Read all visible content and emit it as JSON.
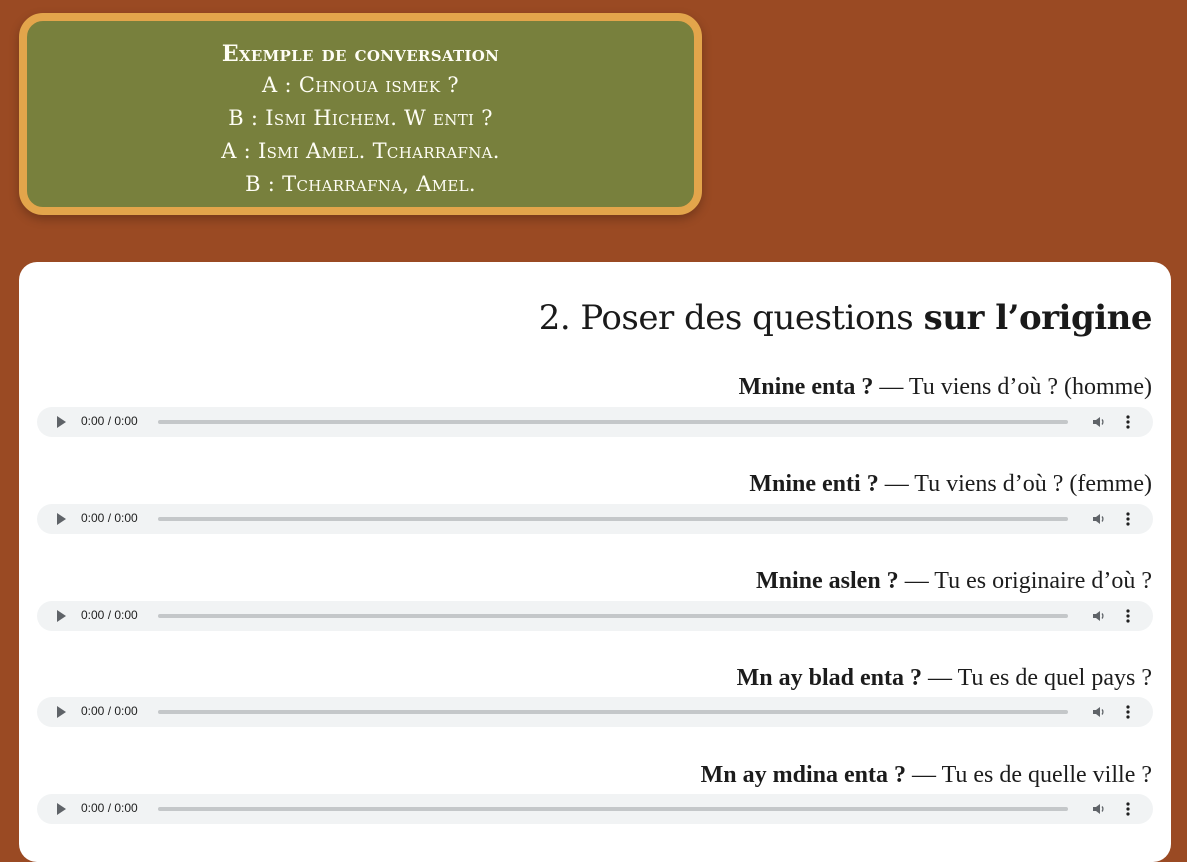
{
  "conversation": {
    "title": "Exemple de conversation",
    "lines": [
      "A : Chnoua ismek ?",
      "B : Ismi Hichem. W enti ?",
      "A : Ismi Amel. Tcharrafna.",
      "B : Tcharrafna, Amel."
    ]
  },
  "section": {
    "title_regular": "2. Poser des questions ",
    "title_bold": "sur l’origine"
  },
  "phrases": [
    {
      "arabic": "Mnine enta ?",
      "translation": " — Tu viens d’où ? (homme)",
      "time": "0:00 / 0:00"
    },
    {
      "arabic": "Mnine enti ?",
      "translation": " — Tu viens d’où ? (femme)",
      "time": "0:00 / 0:00"
    },
    {
      "arabic": "Mnine aslen ?",
      "translation": " — Tu es originaire d’où ?",
      "time": "0:00 / 0:00"
    },
    {
      "arabic": "Mn ay blad enta ?",
      "translation": " — Tu es de quel pays ?",
      "time": "0:00 / 0:00"
    },
    {
      "arabic": "Mn ay mdina enta ?",
      "translation": " — Tu es de quelle ville ?",
      "time": "0:00 / 0:00"
    }
  ],
  "icons": {
    "play": "play-icon",
    "volume": "volume-icon",
    "more": "more-options-icon"
  },
  "colors": {
    "background": "#9a4a23",
    "box_fill": "#78803d",
    "box_border": "#e3a54b",
    "card": "#ffffff"
  }
}
